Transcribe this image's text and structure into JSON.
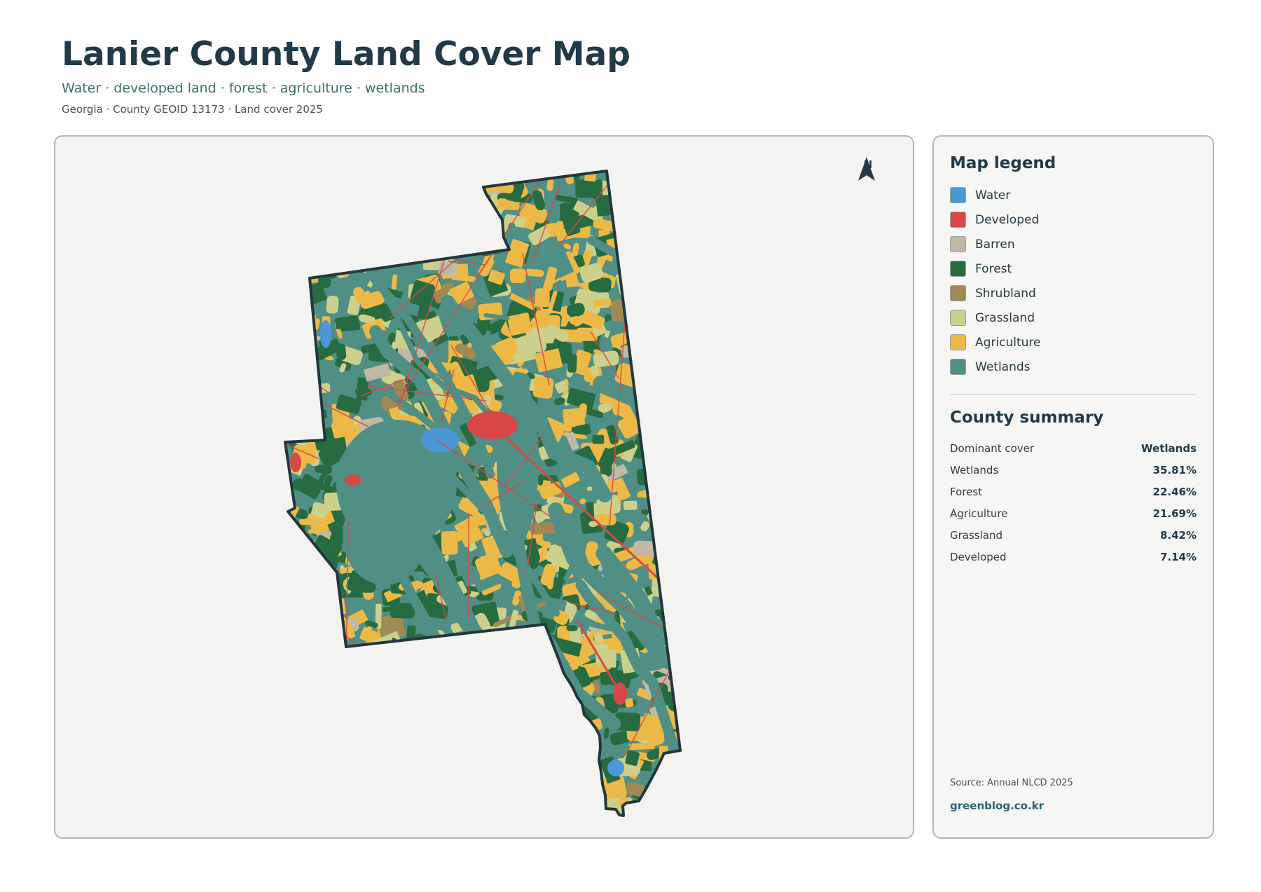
{
  "header": {
    "title": "Lanier County Land Cover Map",
    "subtitle": "Water · developed land · forest · agriculture · wetlands",
    "meta": "Georgia · County GEOID 13173 · Land cover 2025"
  },
  "map": {
    "north_label": "N",
    "base_color": "#4f8f86",
    "border_color": "#22363d"
  },
  "legend": {
    "title": "Map legend",
    "items": [
      {
        "label": "Water",
        "color": "#4a98d6"
      },
      {
        "label": "Developed",
        "color": "#d94848"
      },
      {
        "label": "Barren",
        "color": "#c2b8a3"
      },
      {
        "label": "Forest",
        "color": "#276b40"
      },
      {
        "label": "Shrubland",
        "color": "#a08955"
      },
      {
        "label": "Grassland",
        "color": "#cdd08a"
      },
      {
        "label": "Agriculture",
        "color": "#ecb946"
      },
      {
        "label": "Wetlands",
        "color": "#4f8f86"
      }
    ]
  },
  "summary": {
    "title": "County summary",
    "rows": [
      {
        "key": "Dominant cover",
        "value": "Wetlands"
      },
      {
        "key": "Wetlands",
        "value": "35.81%"
      },
      {
        "key": "Forest",
        "value": "22.46%"
      },
      {
        "key": "Agriculture",
        "value": "21.69%"
      },
      {
        "key": "Grassland",
        "value": "8.42%"
      },
      {
        "key": "Developed",
        "value": "7.14%"
      }
    ]
  },
  "footer": {
    "source": "Source: Annual NLCD 2025",
    "brand": "greenblog.co.kr"
  }
}
